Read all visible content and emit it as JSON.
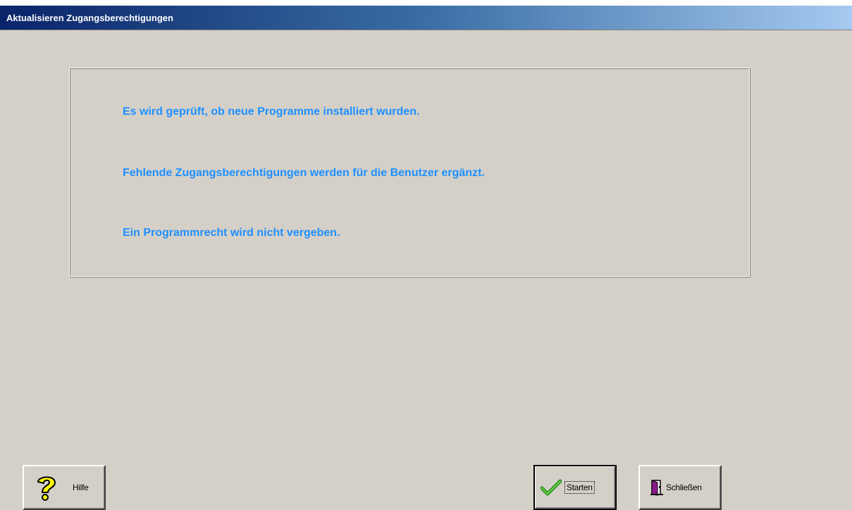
{
  "window": {
    "title": "Aktualisieren Zugangsberechtigungen"
  },
  "info": {
    "lines": [
      "Es wird geprüft, ob neue Programme installiert wurden.",
      "Fehlende Zugangsberechtigungen werden für die Benutzer ergänzt.",
      "Ein Programmrecht wird nicht vergeben."
    ],
    "text_color": "#1e90ff"
  },
  "buttons": {
    "help": {
      "label": "Hilfe",
      "icon": "question-mark-icon"
    },
    "start": {
      "label": "Starten",
      "icon": "checkmark-icon"
    },
    "close": {
      "label": "Schließen",
      "icon": "door-exit-icon"
    }
  },
  "colors": {
    "face": "#d4d0c8",
    "title_start": "#0a246a",
    "title_end": "#a6caf0"
  }
}
